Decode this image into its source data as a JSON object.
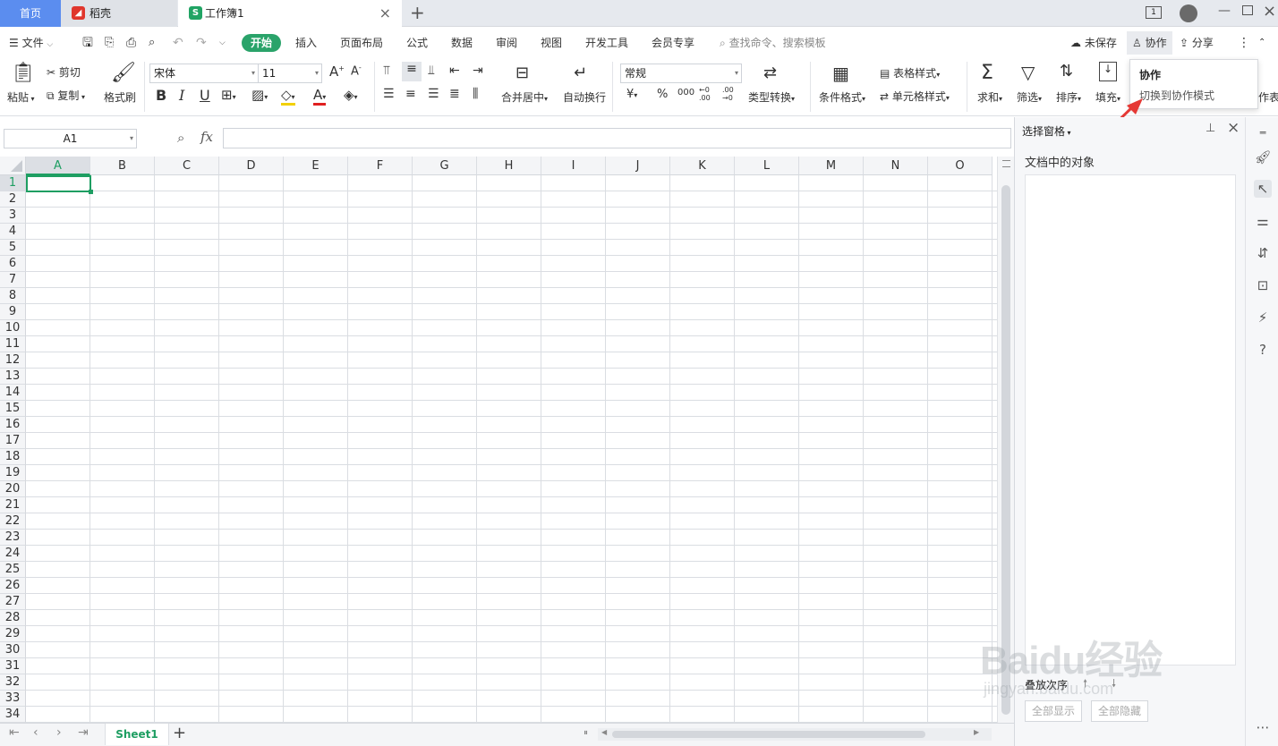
{
  "tabs": {
    "home": "首页",
    "daoke": "稻壳",
    "workbook": "工作簿1",
    "close": "×",
    "add": "+",
    "window_count": "1"
  },
  "menu": {
    "file": "文件",
    "items": [
      "开始",
      "插入",
      "页面布局",
      "公式",
      "数据",
      "审阅",
      "视图",
      "开发工具",
      "会员专享"
    ],
    "search_placeholder": "查找命令、搜索模板",
    "unsaved": "未保存",
    "collab": "协作",
    "share": "分享"
  },
  "ribbon": {
    "paste": "粘贴",
    "cut": "剪切",
    "copy": "复制",
    "format_painter": "格式刷",
    "font_name": "宋体",
    "font_size": "11",
    "bold": "B",
    "italic": "I",
    "underline": "U",
    "merge_center": "合并居中",
    "wrap_text": "自动换行",
    "number_format": "常规",
    "currency": "¥",
    "percent": "%",
    "thousands": "000",
    "dec_inc": "←0 .00",
    "dec_dec": ".00 →0",
    "type_convert": "类型转换",
    "cond_format": "条件格式",
    "table_style": "表格样式",
    "cell_style": "单元格样式",
    "sum": "求和",
    "filter": "筛选",
    "sort": "排序",
    "fill": "填充",
    "worksheet_partial": "作表"
  },
  "tooltip": {
    "title": "协作",
    "desc": "切换到协作模式"
  },
  "formula_bar": {
    "name_box": "A1",
    "fx": "fx",
    "formula": ""
  },
  "grid": {
    "columns": [
      "A",
      "B",
      "C",
      "D",
      "E",
      "F",
      "G",
      "H",
      "I",
      "J",
      "K",
      "L",
      "M",
      "N",
      "O"
    ],
    "rows": [
      "1",
      "2",
      "3",
      "4",
      "5",
      "6",
      "7",
      "8",
      "9",
      "10",
      "11",
      "12",
      "13",
      "14",
      "15",
      "16",
      "17",
      "18",
      "19",
      "20",
      "21",
      "22",
      "23",
      "24",
      "25",
      "26",
      "27",
      "28",
      "29",
      "30",
      "31",
      "32",
      "33",
      "34"
    ],
    "selected_cell": "A1"
  },
  "sheets": {
    "active": "Sheet1",
    "add": "+"
  },
  "pane": {
    "title": "选择窗格",
    "objects_label": "文档中的对象",
    "stack_order": "叠放次序",
    "show_all": "全部显示",
    "hide_all": "全部隐藏"
  },
  "watermark": {
    "brand": "Baidu经验",
    "url": "jingyan.baidu.com"
  },
  "colors": {
    "accent_green": "#2aa36a",
    "home_tab_blue": "#5b8def",
    "selection_green": "#1e9e62",
    "arrow_red": "#e53935"
  }
}
